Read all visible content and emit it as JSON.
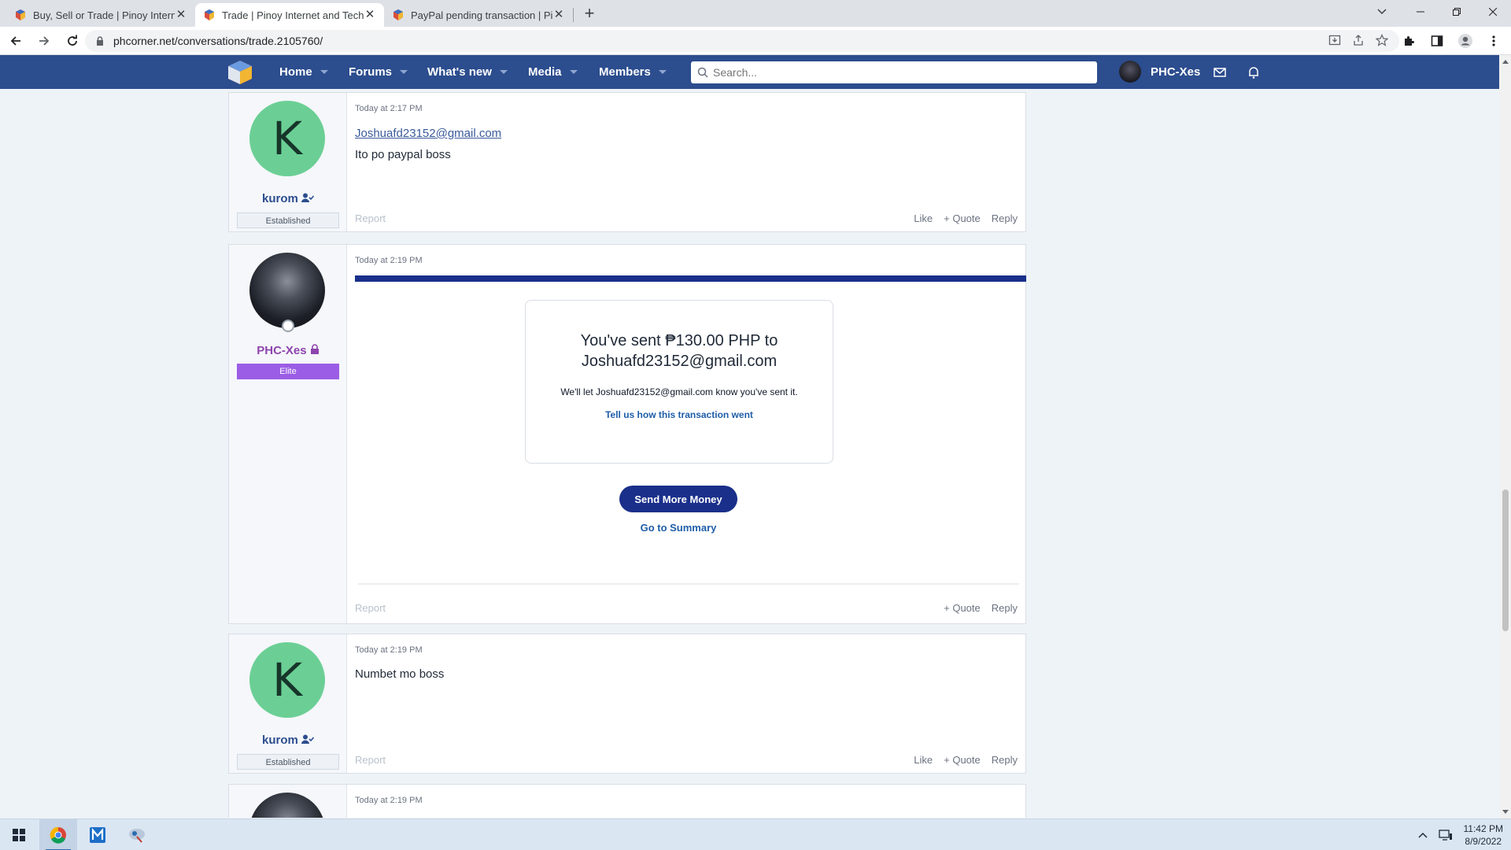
{
  "browser": {
    "tabs": [
      {
        "title": "Buy, Sell or Trade | Pinoy Internet",
        "active": false
      },
      {
        "title": "Trade | Pinoy Internet and Techno",
        "active": true
      },
      {
        "title": "PayPal pending transaction | Pino",
        "active": false
      }
    ],
    "url": "phcorner.net/conversations/trade.2105760/"
  },
  "site_nav": {
    "items": [
      {
        "label": "Home"
      },
      {
        "label": "Forums"
      },
      {
        "label": "What's new"
      },
      {
        "label": "Media"
      },
      {
        "label": "Members"
      }
    ],
    "search_placeholder": "Search...",
    "username": "PHC-Xes"
  },
  "posts": [
    {
      "author": "kurom",
      "avatar_letter": "K",
      "badge": "Established",
      "time": "Today at 2:17 PM",
      "link": "Joshuafd23152@gmail.com",
      "text": "Ito po paypal boss",
      "report": "Report",
      "actions": [
        "Like",
        "+ Quote",
        "Reply"
      ]
    },
    {
      "author": "PHC-Xes",
      "badge": "Elite",
      "time": "Today at 2:19 PM",
      "paypal": {
        "headline_1": "You've sent ₱130.00 PHP to",
        "headline_2": "Joshuafd23152@gmail.com",
        "subtext": "We'll let Joshuafd23152@gmail.com know you've sent it.",
        "feedback_link": "Tell us how this transaction went",
        "send_more": "Send More Money",
        "summary": "Go to Summary"
      },
      "report": "Report",
      "actions": [
        "+ Quote",
        "Reply"
      ]
    },
    {
      "author": "kurom",
      "avatar_letter": "K",
      "badge": "Established",
      "time": "Today at 2:19 PM",
      "text": "Numbet mo boss",
      "report": "Report",
      "actions": [
        "Like",
        "+ Quote",
        "Reply"
      ]
    },
    {
      "time": "Today at 2:19 PM"
    }
  ],
  "taskbar": {
    "time": "11:42 PM",
    "date": "8/9/2022"
  },
  "colors": {
    "nav_bg": "#2c4d8e",
    "paypal_blue": "#1a2f8a",
    "elite_badge": "#9b5de5",
    "avatar_green": "#6bcf95"
  }
}
